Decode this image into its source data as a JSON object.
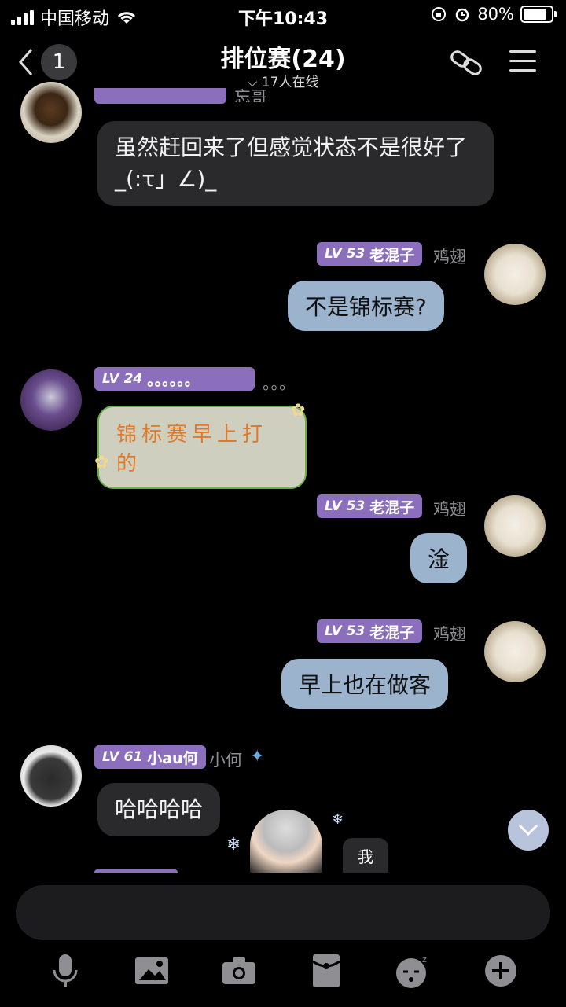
{
  "status_bar": {
    "carrier": "中国移动",
    "time": "下午10:43",
    "battery": "80%"
  },
  "nav": {
    "back_count": "1",
    "title": "排位赛(24)",
    "online": "17人在线"
  },
  "messages": [
    {
      "text": "虽然赶回来了但感觉状态不是很好了_(:τ」∠)_",
      "partial_nick": "忘哥"
    },
    {
      "tag_level": "LV 53",
      "tag_title": "老混子",
      "nick": "鸡翅",
      "text": "不是锦标赛?"
    },
    {
      "tag_level": "LV 24",
      "tag_title": "。。。。。。",
      "nick": "。。。",
      "text": "锦标赛早上打的"
    },
    {
      "tag_level": "LV 53",
      "tag_title": "老混子",
      "nick": "鸡翅",
      "text": "淦"
    },
    {
      "tag_level": "LV 53",
      "tag_title": "老混子",
      "nick": "鸡翅",
      "text": "早上也在做客"
    },
    {
      "tag_level": "LV 61",
      "tag_title": "小au何",
      "nick": "小何",
      "text": "哈哈哈哈",
      "sticker_text": "我"
    }
  ],
  "colors": {
    "tag_purple": "#8b6fbd",
    "bubble_dark": "#2a2a2c",
    "bubble_blue": "#9bb3cd",
    "green_border": "#6ab04c"
  }
}
